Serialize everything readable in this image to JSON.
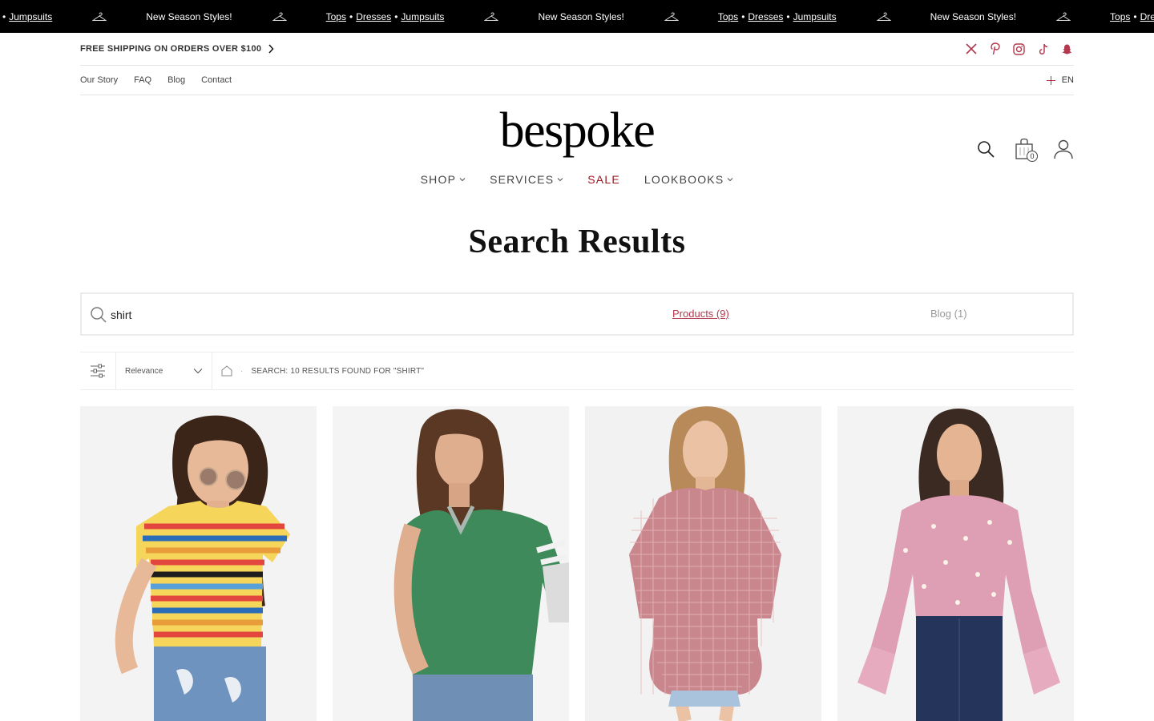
{
  "ticker": {
    "link_tops": "Tops",
    "link_dresses": "Dresses",
    "link_jumpsuits": "Jumpsuits",
    "separator": "•",
    "promo_text": "New Season Styles!",
    "icon": "hanger-icon"
  },
  "topbar": {
    "shipping_text": "FREE SHIPPING ON ORDERS OVER $100",
    "socials": [
      "x-icon",
      "pinterest-icon",
      "instagram-icon",
      "tiktok-icon",
      "snapchat-icon"
    ],
    "social_color": "#b33a4e"
  },
  "utility_nav": {
    "links": [
      "Our Story",
      "FAQ",
      "Blog",
      "Contact"
    ],
    "language": "EN"
  },
  "header": {
    "logo": "bespoke",
    "cart_count": "0",
    "nav": [
      {
        "label": "SHOP",
        "dropdown": true
      },
      {
        "label": "SERVICES",
        "dropdown": true
      },
      {
        "label": "SALE",
        "dropdown": false
      },
      {
        "label": "LOOKBOOKS",
        "dropdown": true
      }
    ],
    "sale_color": "#a0141e"
  },
  "page": {
    "title": "Search Results"
  },
  "search": {
    "value": "shirt",
    "tabs": [
      {
        "label": "Products (9)",
        "active": true
      },
      {
        "label": "Blog (1)",
        "active": false
      }
    ],
    "accent": "#b33a4e"
  },
  "toolbar": {
    "sort_selected": "Relevance",
    "breadcrumb_separator": "·",
    "results_text": "SEARCH: 10 RESULTS FOUND FOR \"SHIRT\""
  },
  "products": [
    {
      "image": "striped-crop-tee-image"
    },
    {
      "image": "green-varsity-vneck-image"
    },
    {
      "image": "pink-gingham-blouse-image"
    },
    {
      "image": "pink-pearl-bell-sleeve-blouse-image"
    }
  ]
}
